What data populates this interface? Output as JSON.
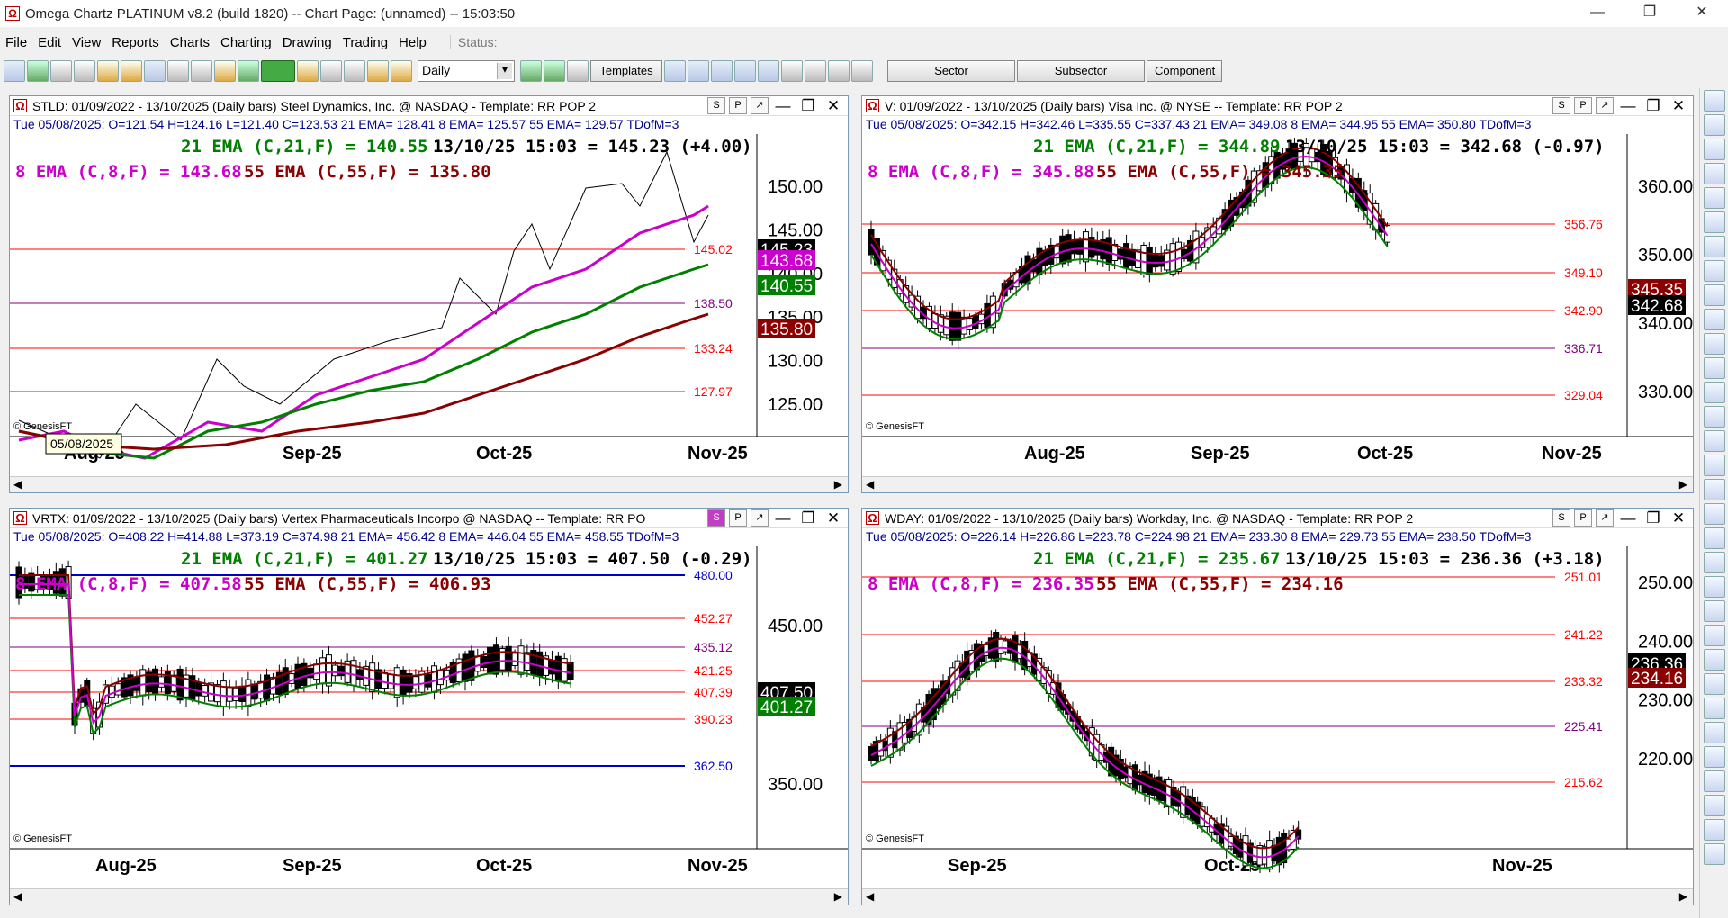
{
  "window": {
    "title": "Omega Chartz PLATINUM v8.2 (build 1820)  --  Chart Page: (unnamed) -- 15:03:50",
    "icon": "omega-icon"
  },
  "menu": [
    "File",
    "Edit",
    "View",
    "Reports",
    "Charts",
    "Charting",
    "Drawing",
    "Trading",
    "Help"
  ],
  "status_label": "Status:",
  "toolbar": {
    "period": "Daily",
    "templates": "Templates",
    "sector": "Sector",
    "subsector": "Subsector",
    "component": "Component"
  },
  "colors": {
    "ema21": "#008000",
    "ema8": "#cc00cc",
    "ema55": "#8b0000",
    "hline_red": "#ff0000",
    "hline_purple": "#800080",
    "hline_blue": "#0000cc",
    "ohlc": "#00008b"
  },
  "panes": [
    {
      "id": "stld",
      "title": "STLD: 01/09/2022 - 13/10/2025  (Daily bars)  Steel Dynamics, Inc. @ NASDAQ  -  Template: RR POP 2",
      "ohlc": "Tue  05/08/2025:  O=121.54  H=124.16  L=121.40  C=123.53  21 EMA= 128.41  8 EMA= 125.57  55 EMA= 129.57  TDofM=3",
      "ema21_text": "21 EMA (C,21,F) = 140.55",
      "quote": "13/10/25 15:03 = 145.23 (+4.00)",
      "ema8_text": "8 EMA (C,8,F) = 143.68",
      "ema55_text": "55 EMA (C,55,F) = 135.80",
      "tooltip": "05/08/2025",
      "copyright": "© GenesisFT",
      "x_labels": [
        "Aug-25",
        "Sep-25",
        "Oct-25",
        "Nov-25"
      ],
      "y_ticks": [
        "150.00",
        "145.00",
        "140.00",
        "135.00",
        "130.00",
        "125.00"
      ],
      "hlines": [
        {
          "v": "145.02",
          "c": "red"
        },
        {
          "v": "138.50",
          "c": "purple"
        },
        {
          "v": "133.24",
          "c": "red"
        },
        {
          "v": "127.97",
          "c": "red"
        }
      ],
      "price_tags": [
        {
          "v": "145.23",
          "bg": "#000"
        },
        {
          "v": "143.68",
          "bg": "#cc00cc"
        },
        {
          "v": "140.55",
          "bg": "#008000"
        },
        {
          "v": "135.80",
          "bg": "#8b0000"
        }
      ],
      "chart_type": "line"
    },
    {
      "id": "v",
      "title": "V: 01/09/2022 - 13/10/2025  (Daily bars)  Visa Inc. @ NYSE  --  Template: RR POP 2",
      "ohlc": "Tue  05/08/2025:  O=342.15  H=342.46  L=335.55  C=337.43  21 EMA= 349.08  8 EMA= 344.95  55 EMA= 350.80  TDofM=3",
      "ema21_text": "21 EMA (C,21,F) = 344.89",
      "quote": "13/10/25 15:03 = 342.68 (-0.97)",
      "ema8_text": "8 EMA (C,8,F) = 345.88",
      "ema55_text": "55 EMA (C,55,F) = 345.35",
      "copyright": "© GenesisFT",
      "x_labels": [
        "Aug-25",
        "Sep-25",
        "Oct-25",
        "Nov-25"
      ],
      "y_ticks": [
        "360.00",
        "350.00",
        "340.00",
        "330.00"
      ],
      "hlines": [
        {
          "v": "356.76",
          "c": "red"
        },
        {
          "v": "349.10",
          "c": "red"
        },
        {
          "v": "342.90",
          "c": "red"
        },
        {
          "v": "336.71",
          "c": "purple"
        },
        {
          "v": "329.04",
          "c": "red"
        }
      ],
      "price_tags": [
        {
          "v": "345.35",
          "bg": "#8b0000"
        },
        {
          "v": "342.68",
          "bg": "#000"
        }
      ],
      "chart_type": "candle"
    },
    {
      "id": "vrtx",
      "title": "VRTX: 01/09/2022 - 13/10/2025  (Daily bars)  Vertex Pharmaceuticals Incorpo @ NASDAQ  --  Template: RR PO",
      "ohlc": "Tue  05/08/2025:  O=408.22  H=414.88  L=373.19  C=374.98  21 EMA= 456.42  8 EMA= 446.04  55 EMA= 458.55  TDofM=3",
      "ema21_text": "21 EMA (C,21,F) = 401.27",
      "quote": "13/10/25 15:03 = 407.50 (-0.29)",
      "ema8_text": "8 EMA (C,8,F) = 407.58",
      "ema55_text": "55 EMA (C,55,F) = 406.93",
      "copyright": "© GenesisFT",
      "x_labels": [
        "Aug-25",
        "Sep-25",
        "Oct-25",
        "Nov-25"
      ],
      "y_ticks": [
        "450.00",
        "350.00"
      ],
      "hlines": [
        {
          "v": "480.00",
          "c": "blue"
        },
        {
          "v": "452.27",
          "c": "red"
        },
        {
          "v": "435.12",
          "c": "purple"
        },
        {
          "v": "421.25",
          "c": "red"
        },
        {
          "v": "407.39",
          "c": "red"
        },
        {
          "v": "390.23",
          "c": "red"
        },
        {
          "v": "362.50",
          "c": "blue"
        }
      ],
      "price_tags": [
        {
          "v": "407.50",
          "bg": "#000"
        },
        {
          "v": "401.27",
          "bg": "#008000"
        }
      ],
      "chart_type": "candle"
    },
    {
      "id": "wday",
      "title": "WDAY: 01/09/2022 - 13/10/2025  (Daily bars)  Workday, Inc. @ NASDAQ  -  Template: RR POP 2",
      "ohlc": "Tue  05/08/2025:  O=226.14  H=226.86  L=223.78  C=224.98  21 EMA= 233.30  8 EMA= 229.73  55 EMA= 238.50  TDofM=3",
      "ema21_text": "21 EMA (C,21,F) = 235.67",
      "quote": "13/10/25 15:03 = 236.36 (+3.18)",
      "ema8_text": "8 EMA (C,8,F) = 236.35",
      "ema55_text": "55 EMA (C,55,F) = 234.16",
      "copyright": "© GenesisFT",
      "x_labels": [
        "Sep-25",
        "Oct-25",
        "Nov-25"
      ],
      "y_ticks": [
        "250.00",
        "240.00",
        "230.00",
        "220.00"
      ],
      "hlines": [
        {
          "v": "251.01",
          "c": "red"
        },
        {
          "v": "241.22",
          "c": "red"
        },
        {
          "v": "233.32",
          "c": "red"
        },
        {
          "v": "225.41",
          "c": "purple"
        },
        {
          "v": "215.62",
          "c": "red"
        }
      ],
      "price_tags": [
        {
          "v": "236.36",
          "bg": "#000"
        },
        {
          "v": "234.16",
          "bg": "#8b0000"
        }
      ],
      "chart_type": "candle"
    }
  ]
}
